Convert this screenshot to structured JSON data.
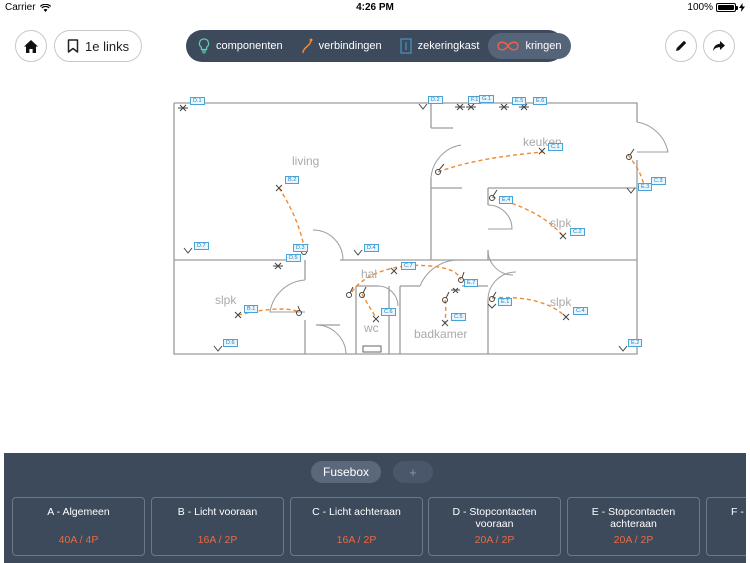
{
  "status": {
    "carrier": "Carrier",
    "time": "4:26 PM",
    "battery": "100%"
  },
  "toolbar": {
    "links_label": "1e links",
    "modes": [
      {
        "label": "componenten",
        "active": false
      },
      {
        "label": "verbindingen",
        "active": false
      },
      {
        "label": "zekeringkast",
        "active": false
      },
      {
        "label": "kringen",
        "active": true
      }
    ]
  },
  "colors": {
    "panel": "#3d4a5c",
    "accent": "#e96a3f",
    "wire": "#f08a2e",
    "tag_border": "#4aa3d8"
  },
  "rooms": {
    "living": "living",
    "keuken": "keuken",
    "slpk_1": "slpk",
    "slpk_2": "slpk",
    "slpk_3": "slpk",
    "hal": "hal",
    "wc": "wc",
    "badkamer": "badkamer"
  },
  "tags": [
    "D.1",
    "D.2",
    "F.1",
    "G.1",
    "E.5",
    "E.6",
    "C.1",
    "C.3",
    "E.3",
    "B.2",
    "E.4",
    "C.2",
    "D.7",
    "D.3",
    "D.5",
    "D.4",
    "C.7",
    "E.7",
    "B.1",
    "E.1",
    "C.4",
    "C.6",
    "C.5",
    "D.6",
    "E.2"
  ],
  "fusebox": {
    "tab_label": "Fusebox",
    "add_label": "+",
    "groups": [
      {
        "name": "A - Algemeen",
        "rating": "40A / 4P"
      },
      {
        "name": "B - Licht vooraan",
        "rating": "16A / 2P"
      },
      {
        "name": "C - Licht achteraan",
        "rating": "16A / 2P"
      },
      {
        "name": "D - Stopcontacten vooraan",
        "rating": "20A / 2P"
      },
      {
        "name": "E - Stopcontacten achteraan",
        "rating": "20A / 2P"
      },
      {
        "name": "F -",
        "rating": ""
      }
    ]
  }
}
